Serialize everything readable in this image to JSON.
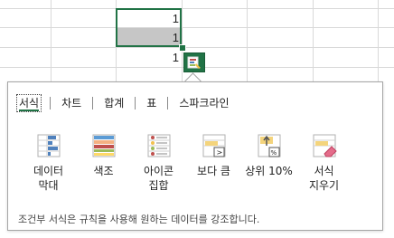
{
  "cells": [
    "1",
    "1",
    "1"
  ],
  "tabs": [
    {
      "label": "서식",
      "active": true
    },
    {
      "label": "차트",
      "active": false
    },
    {
      "label": "합계",
      "active": false
    },
    {
      "label": "표",
      "active": false
    },
    {
      "label": "스파크라인",
      "active": false
    }
  ],
  "items": [
    {
      "label": "데이터\n막대",
      "icon": "data-bar-icon"
    },
    {
      "label": "색조",
      "icon": "color-scale-icon"
    },
    {
      "label": "아이콘\n집합",
      "icon": "icon-set-icon"
    },
    {
      "label": "보다 큼",
      "icon": "greater-than-icon"
    },
    {
      "label": "상위 10%",
      "icon": "top-10-percent-icon"
    },
    {
      "label": "서식\n지우기",
      "icon": "clear-format-icon"
    }
  ],
  "description": "조건부 서식은 규칙을 사용해 원하는 데이터를 강조합니다.",
  "colors": {
    "accent": "#217346",
    "selection_fill": "#c6c6c6",
    "gridline": "#d9d9d9"
  }
}
